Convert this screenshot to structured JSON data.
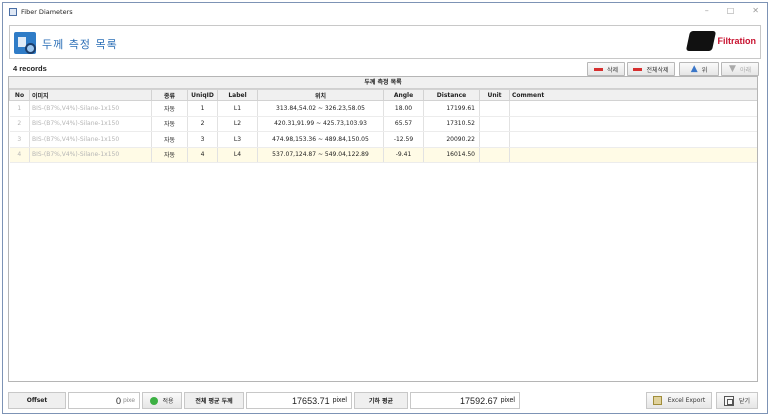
{
  "window": {
    "title": "Fiber Diameters"
  },
  "header": {
    "title": "두께 측정 목록",
    "brand_text": "Filtration"
  },
  "toolbar": {
    "records": "4 records",
    "delete_label": "삭제",
    "delete_all_label": "전체삭제",
    "up_label": "위",
    "down_label": "아래"
  },
  "grid": {
    "caption": "두께 측정 목록",
    "columns": [
      "No",
      "이미지",
      "종류",
      "UniqID",
      "Label",
      "위치",
      "Angle",
      "Distance",
      "Unit",
      "Comment"
    ],
    "rows": [
      {
        "no": "1",
        "image": "BIS-(B7%,V4%)-Silane-1x150",
        "type": "자동",
        "uniqid": "1",
        "label": "L1",
        "position": "313.84,54.02 ~ 326.23,58.05",
        "angle": "18.00",
        "distance": "17199.61",
        "unit": "",
        "comment": ""
      },
      {
        "no": "2",
        "image": "BIS-(B7%,V4%)-Silane-1x150",
        "type": "자동",
        "uniqid": "2",
        "label": "L2",
        "position": "420.31,91.99 ~ 425.73,103.93",
        "angle": "65.57",
        "distance": "17310.52",
        "unit": "",
        "comment": ""
      },
      {
        "no": "3",
        "image": "BIS-(B7%,V4%)-Silane-1x150",
        "type": "자동",
        "uniqid": "3",
        "label": "L3",
        "position": "474.98,153.36 ~ 489.84,150.05",
        "angle": "-12.59",
        "distance": "20090.22",
        "unit": "",
        "comment": ""
      },
      {
        "no": "4",
        "image": "BIS-(B7%,V4%)-Silane-1x150",
        "type": "자동",
        "uniqid": "4",
        "label": "L4",
        "position": "537.07,124.87 ~ 549.04,122.89",
        "angle": "-9.41",
        "distance": "16014.50",
        "unit": "",
        "comment": ""
      }
    ]
  },
  "footer": {
    "offset_label": "Offset",
    "offset_value": "0",
    "offset_unit": "pixe",
    "apply_label": "적용",
    "overall_avg_label": "전체 평균 두께",
    "overall_avg_value": "17653.71",
    "overall_avg_unit": "pixel",
    "geo_avg_label": "기하 평균",
    "geo_avg_value": "17592.67",
    "geo_avg_unit": "pixel",
    "excel_label": "Excel Export",
    "close_label": "닫기"
  },
  "colors": {
    "accent": "#2c6fb7",
    "brand": "#c8102e",
    "delete": "#d62f2f",
    "apply": "#3cb043"
  }
}
